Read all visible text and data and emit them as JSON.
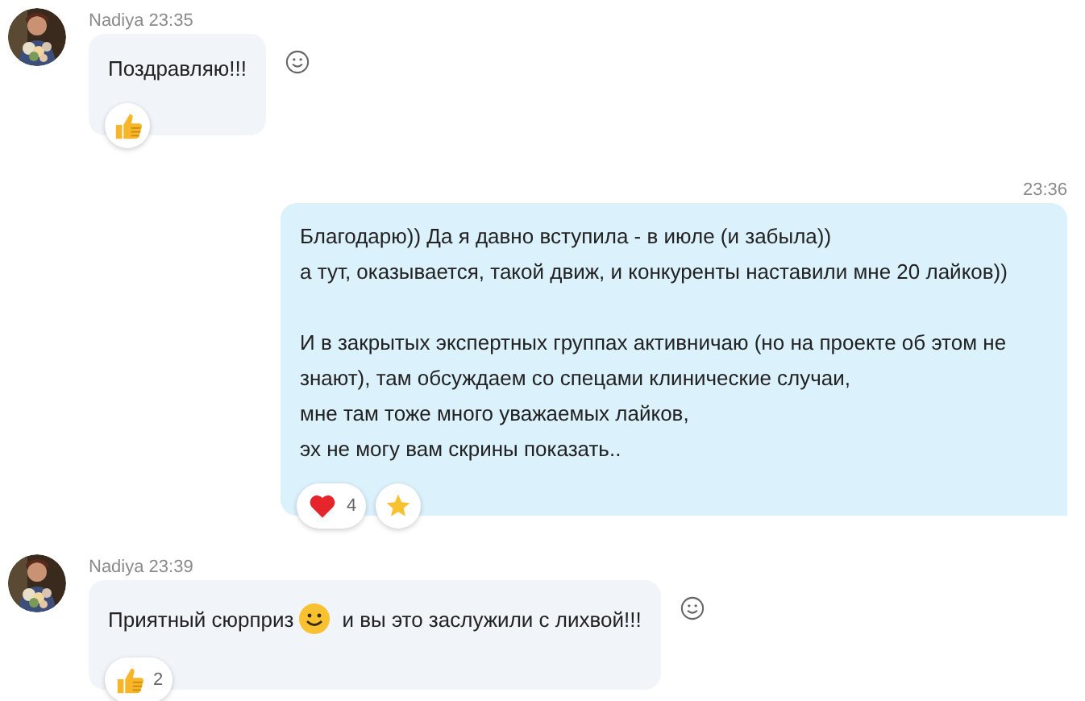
{
  "messages": [
    {
      "kind": "incoming",
      "sender": "Nadiya",
      "time": "23:35",
      "paragraphs": [
        [
          "Поздравляю!!!"
        ]
      ],
      "reactions": [
        {
          "kind": "like"
        }
      ]
    },
    {
      "kind": "outgoing",
      "time": "23:36",
      "paragraphs": [
        [
          "Благодарю)) Да я давно вступила - в июле (и забыла))",
          "а тут, оказывается, такой движ, и конкуренты наставили мне 20 лайков))"
        ],
        [
          "И в закрытых экспертных группах активничаю (но на проекте об этом не",
          "знают), там обсуждаем со спецами клинические случаи,",
          "мне там тоже много уважаемых лайков,",
          "эх не могу вам скрины показать.."
        ]
      ],
      "reactions": [
        {
          "kind": "heart",
          "count": "4"
        },
        {
          "kind": "star"
        }
      ]
    },
    {
      "kind": "incoming",
      "sender": "Nadiya",
      "time": "23:39",
      "text_before_emoji": "Приятный сюрприз",
      "text_after_emoji": "и вы это заслужили с лихвой!!!",
      "reactions": [
        {
          "kind": "like",
          "count": "2"
        }
      ]
    }
  ]
}
